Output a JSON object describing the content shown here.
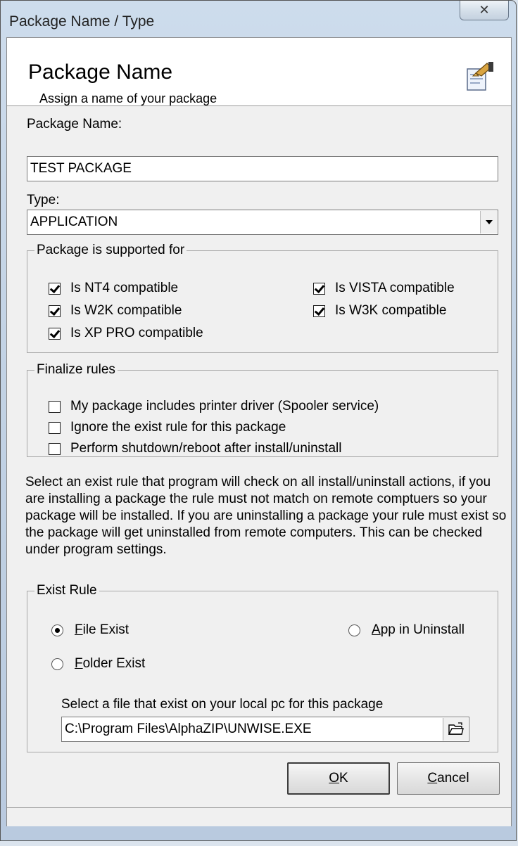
{
  "window": {
    "title": "Package Name / Type",
    "close_glyph": "✕"
  },
  "header": {
    "title": "Package Name",
    "subtitle": "Assign a name of your package",
    "icon": "package-wizard-icon"
  },
  "package_name": {
    "label": "Package Name:",
    "value": "TEST PACKAGE"
  },
  "type": {
    "label": "Type:",
    "selected": "APPLICATION"
  },
  "supported": {
    "legend": "Package is supported for",
    "items": [
      {
        "label": "Is NT4 compatible",
        "checked": true
      },
      {
        "label": "Is W2K compatible",
        "checked": true
      },
      {
        "label": "Is XP PRO compatible",
        "checked": true
      },
      {
        "label": "Is VISTA compatible",
        "checked": true
      },
      {
        "label": "Is W3K compatible",
        "checked": true
      }
    ]
  },
  "finalize": {
    "legend": "Finalize rules",
    "items": [
      {
        "label": "My package includes printer driver (Spooler service)",
        "checked": false
      },
      {
        "label": "Ignore the exist rule for this package",
        "checked": false
      },
      {
        "label": "Perform shutdown/reboot after install/uninstall",
        "checked": false
      }
    ]
  },
  "info_text": "Select an exist rule that program will check on all install/uninstall actions, if you are installing a package the rule must not match on remote comptuers so your package will be installed. If you are uninstalling a package your rule must exist so the package will get uninstalled from remote computers. This can be checked under program settings.",
  "exist_rule": {
    "legend": "Exist Rule",
    "options": [
      {
        "first": "F",
        "rest": "ile Exist",
        "selected": true
      },
      {
        "first": "F",
        "rest": "older Exist",
        "selected": false
      },
      {
        "first": "A",
        "rest": "pp in Uninstall",
        "selected": false
      }
    ],
    "file_label": "Select a file that exist on your local pc for this package",
    "file_path": "C:\\Program Files\\AlphaZIP\\UNWISE.EXE"
  },
  "buttons": {
    "ok": {
      "first": "O",
      "rest": "K"
    },
    "cancel": {
      "first": "C",
      "rest": "ancel"
    }
  },
  "colors": {
    "window_frame": "#c3d3e5",
    "client_bg": "#f0f0f0",
    "header_bg": "#ffffff"
  }
}
